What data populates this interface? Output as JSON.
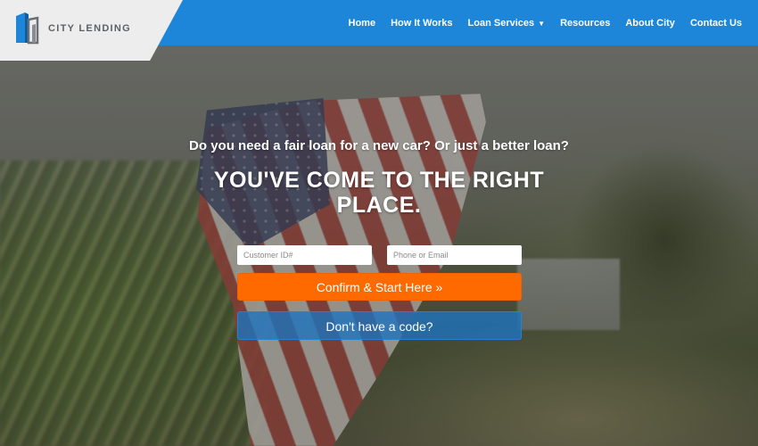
{
  "brand": {
    "name": "CITY LENDING",
    "logo_icon": "city-lending-building-logo"
  },
  "nav": {
    "items": [
      {
        "label": "Home"
      },
      {
        "label": "How It Works"
      },
      {
        "label": "Loan Services",
        "has_dropdown": true
      },
      {
        "label": "Resources"
      },
      {
        "label": "About City"
      },
      {
        "label": "Contact Us"
      }
    ]
  },
  "hero": {
    "subtitle": "Do you need a fair loan for a new car? Or just a better loan?",
    "headline": "YOU'VE COME TO THE RIGHT PLACE."
  },
  "form": {
    "customer_id_placeholder": "Customer ID#",
    "phone_email_placeholder": "Phone or Email",
    "confirm_label": "Confirm & Start Here »",
    "no_code_label": "Don't have a code?"
  },
  "colors": {
    "header": "#1d86d8",
    "logo_panel": "#ededed",
    "confirm_button": "#ff6a00",
    "code_button": "#1e73be"
  }
}
